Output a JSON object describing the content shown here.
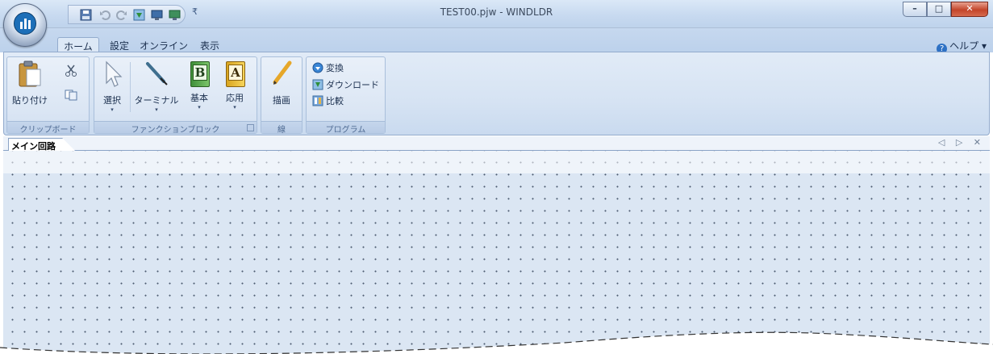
{
  "window": {
    "title": "TEST00.pjw - WINDLDR",
    "buttons": {
      "minimize": "–",
      "maximize": "□",
      "close": "✕"
    }
  },
  "quick_access": {
    "icons": [
      "save-icon",
      "undo-icon",
      "redo-icon",
      "download-icon",
      "monitor-icon",
      "online-icon"
    ],
    "customize": "₹"
  },
  "tabs": [
    {
      "label": "ホーム",
      "active": true
    },
    {
      "label": "設定",
      "active": false
    },
    {
      "label": "オンライン",
      "active": false
    },
    {
      "label": "表示",
      "active": false
    }
  ],
  "help": {
    "label": "ヘルプ",
    "arrow": "▾",
    "icon": "?"
  },
  "ribbon": {
    "clipboard": {
      "label": "クリップボード",
      "paste": "貼り付け"
    },
    "function_block": {
      "label": "ファンクションブロック",
      "select": "選択",
      "terminal": "ターミナル",
      "basic": "基本",
      "basic_glyph": "B",
      "advanced": "応用",
      "advanced_glyph": "A",
      "dropdown": "▾"
    },
    "line": {
      "label": "線",
      "draw": "描画"
    },
    "program": {
      "label": "プログラム",
      "convert": "変換",
      "download": "ダウンロード",
      "compare": "比較"
    }
  },
  "document": {
    "tab_label": "メイン回路",
    "controls": "◁ ▷ ✕"
  },
  "colors": {
    "accent": "#1d6fb8",
    "ribbon_bg": "#d6e3f3",
    "canvas_bg": "#dbe6f3",
    "close_red": "#c3452a"
  }
}
